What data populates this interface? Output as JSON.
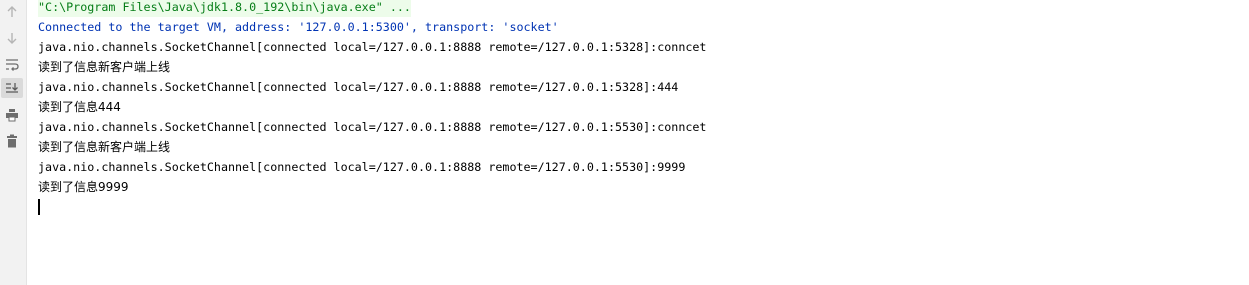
{
  "toolbar": {
    "buttons": [
      {
        "icon": "arrow-up-icon",
        "name": "up-stack-trace-button"
      },
      {
        "icon": "arrow-down-icon",
        "name": "down-stack-trace-button"
      },
      {
        "icon": "soft-wrap-icon",
        "name": "soft-wrap-button"
      },
      {
        "icon": "scroll-to-end-icon",
        "name": "scroll-to-end-button"
      },
      {
        "icon": "print-icon",
        "name": "print-button"
      },
      {
        "icon": "trash-icon",
        "name": "clear-all-button"
      }
    ]
  },
  "console": {
    "command": "\"C:\\Program Files\\Java\\jdk1.8.0_192\\bin\\java.exe\" ...",
    "connected": "Connected to the target VM, address: '127.0.0.1:5300', transport: 'socket'",
    "lines": [
      "java.nio.channels.SocketChannel[connected local=/127.0.0.1:8888 remote=/127.0.0.1:5328]:conncet",
      "读到了信息新客户端上线",
      "java.nio.channels.SocketChannel[connected local=/127.0.0.1:8888 remote=/127.0.0.1:5328]:444",
      "读到了信息444",
      "java.nio.channels.SocketChannel[connected local=/127.0.0.1:8888 remote=/127.0.0.1:5530]:conncet",
      "读到了信息新客户端上线",
      "java.nio.channels.SocketChannel[connected local=/127.0.0.1:8888 remote=/127.0.0.1:5530]:9999",
      "读到了信息9999"
    ]
  },
  "colors": {
    "command_text": "#067d17",
    "command_bg": "#edfcea",
    "system_text": "#0033b3",
    "output_text": "#000000",
    "toolbar_bg": "#f2f2f2"
  }
}
